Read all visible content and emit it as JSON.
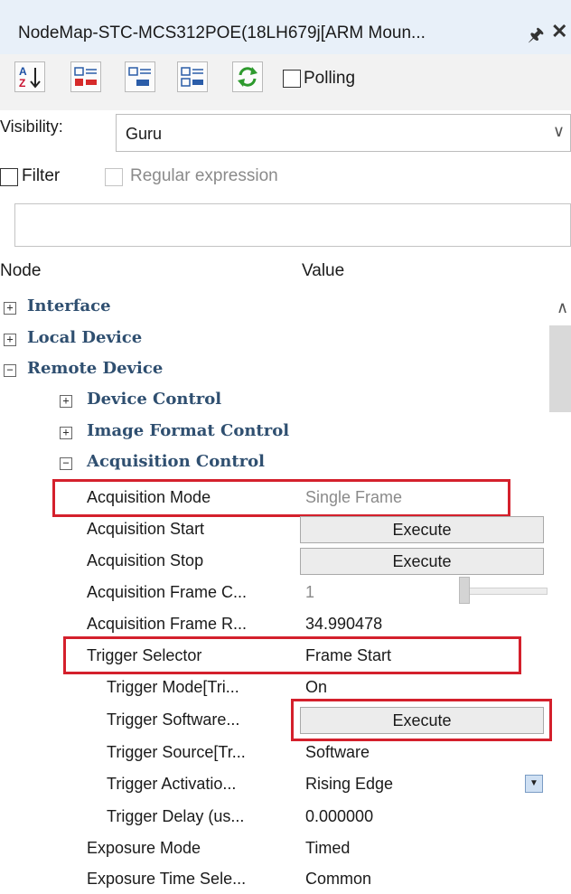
{
  "panel": {
    "title": "NodeMap-STC-MCS312POE(18LH679j[ARM Moun...",
    "pin_icon": "pin-icon",
    "close_label": "✕"
  },
  "toolbar": {
    "polling_label": "Polling",
    "polling_checked": false
  },
  "visibility": {
    "label": "Visibility:",
    "value": "Guru"
  },
  "filter": {
    "filter_label": "Filter",
    "filter_checked": false,
    "regex_label": "Regular expression",
    "regex_checked": false,
    "search_value": ""
  },
  "columns": {
    "node": "Node",
    "value": "Value"
  },
  "tree": {
    "interface": "Interface",
    "local_device": "Local Device",
    "remote_device": "Remote Device",
    "device_control": "Device Control",
    "image_format_control": "Image Format Control",
    "acquisition_control": "Acquisition Control",
    "rows": {
      "acq_mode": {
        "label": "Acquisition Mode",
        "value": "Single Frame"
      },
      "acq_start": {
        "label": "Acquisition Start",
        "value": "Execute"
      },
      "acq_stop": {
        "label": "Acquisition Stop",
        "value": "Execute"
      },
      "acq_frame_count": {
        "label": "Acquisition Frame C...",
        "value": "1"
      },
      "acq_frame_rate": {
        "label": "Acquisition Frame R...",
        "value": "34.990478"
      },
      "trigger_selector": {
        "label": "Trigger Selector",
        "value": "Frame Start"
      },
      "trigger_mode": {
        "label": "Trigger Mode[Tri...",
        "value": "On"
      },
      "trigger_software": {
        "label": "Trigger Software...",
        "value": "Execute"
      },
      "trigger_source": {
        "label": "Trigger Source[Tr...",
        "value": "Software"
      },
      "trigger_activation": {
        "label": "Trigger Activatio...",
        "value": "Rising Edge"
      },
      "trigger_delay": {
        "label": "Trigger Delay (us...",
        "value": "0.000000"
      },
      "exposure_mode": {
        "label": "Exposure Mode",
        "value": "Timed"
      },
      "exposure_time_sel": {
        "label": "Exposure Time Sele...",
        "value": "Common"
      }
    }
  },
  "colors": {
    "highlight_red": "#d4202c",
    "category_blue": "#2f4f70",
    "title_bg": "#e8f0f9"
  }
}
